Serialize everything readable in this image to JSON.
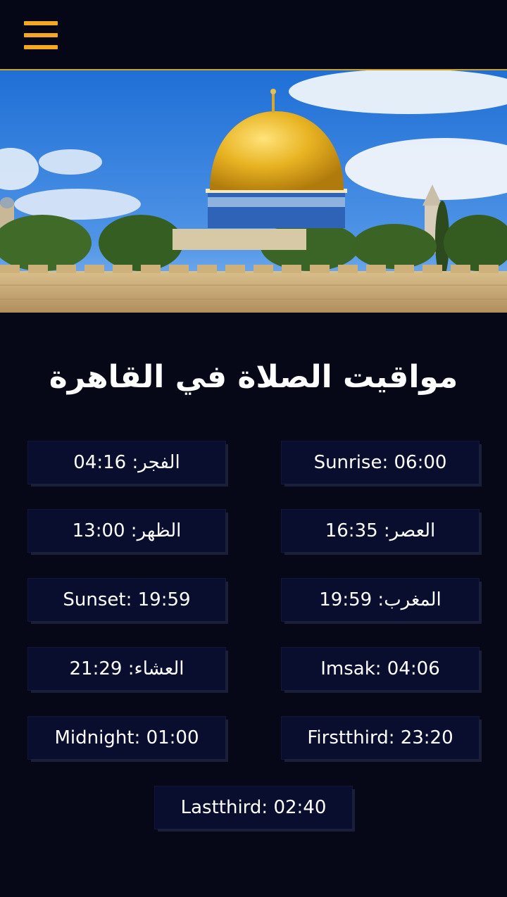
{
  "header": {
    "menu_icon": "hamburger-menu-icon",
    "accent_color": "#f5a623"
  },
  "hero": {
    "image": "dome-of-the-rock-jerusalem"
  },
  "title": "مواقيت الصلاة في القاهرة",
  "times": {
    "fajr": "الفجر: 04:16",
    "sunrise": "Sunrise: 06:00",
    "dhuhr": "الظهر: 13:00",
    "asr": "العصر: 16:35",
    "sunset": "Sunset: 19:59",
    "maghrib": "المغرب: 19:59",
    "isha": "العشاء: 21:29",
    "imsak": "Imsak: 04:06",
    "midnight": "Midnight: 01:00",
    "firstthird": "Firstthird: 23:20",
    "lastthird": "Lastthird: 02:40"
  }
}
